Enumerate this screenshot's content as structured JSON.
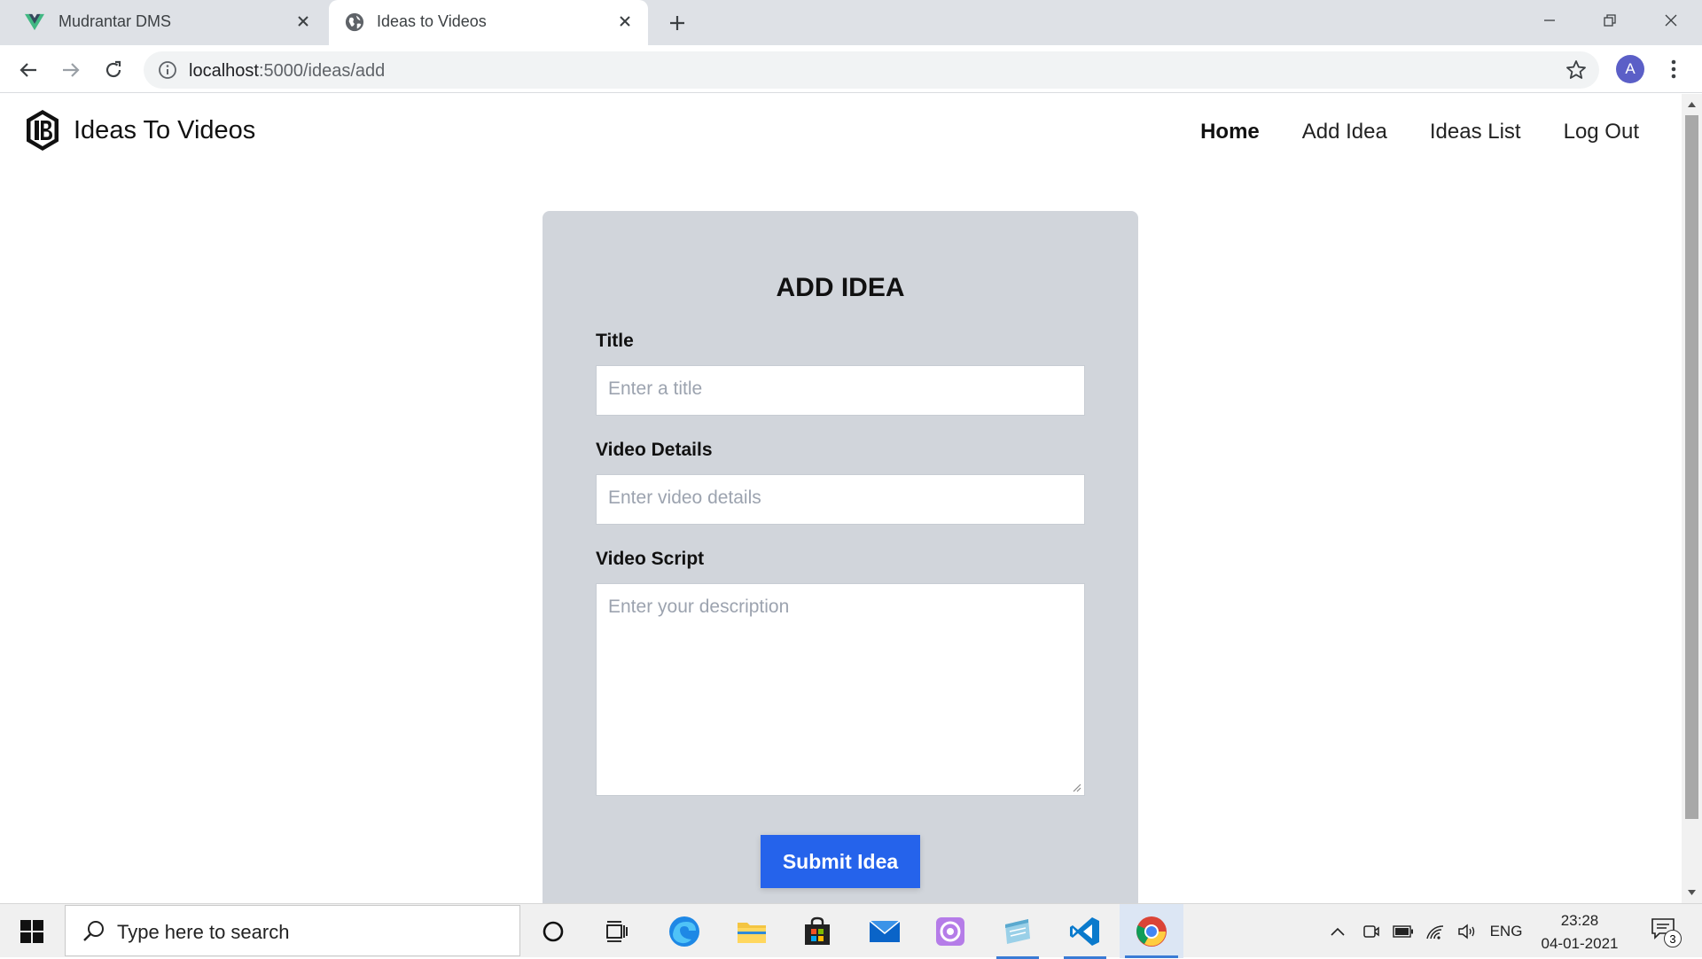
{
  "browser": {
    "tabs": [
      {
        "title": "Mudrantar DMS",
        "favicon": "vue-icon",
        "active": false
      },
      {
        "title": "Ideas to Videos",
        "favicon": "globe-icon",
        "active": true
      }
    ],
    "url_host": "localhost",
    "url_path": ":5000/ideas/add",
    "profile_initial": "A"
  },
  "site": {
    "brand": "Ideas To Videos",
    "nav": {
      "home": "Home",
      "add_idea": "Add Idea",
      "ideas_list": "Ideas List",
      "logout": "Log Out"
    }
  },
  "form": {
    "heading": "ADD IDEA",
    "title_label": "Title",
    "title_placeholder": "Enter a title",
    "details_label": "Video Details",
    "details_placeholder": "Enter video details",
    "script_label": "Video Script",
    "script_placeholder": "Enter your description",
    "submit_label": "Submit Idea"
  },
  "taskbar": {
    "search_placeholder": "Type here to search",
    "language": "ENG",
    "time": "23:28",
    "date": "04-01-2021",
    "notification_count": "3"
  },
  "colors": {
    "card_bg": "#d1d5db",
    "submit_bg": "#2563eb"
  }
}
